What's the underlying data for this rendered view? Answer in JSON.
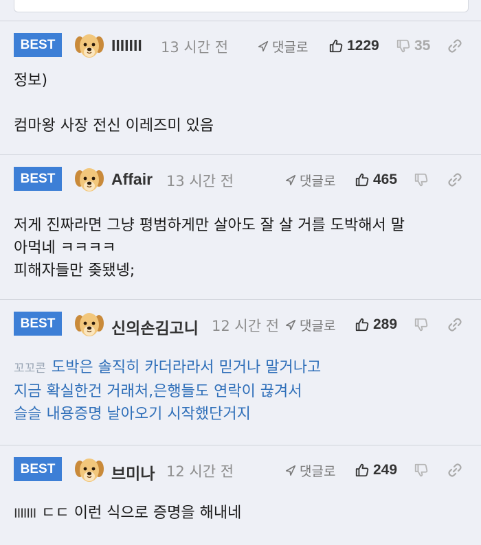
{
  "comments": [
    {
      "badge": "BEST",
      "nickname": "IIIIIII",
      "time": "13 시간 전",
      "reply_label": "댓글로",
      "likes": "1229",
      "dislikes": "35",
      "body_lines": [
        "정보)",
        "",
        "컴마왕 사장 전신 이레즈미 있음"
      ]
    },
    {
      "badge": "BEST",
      "nickname": "Affair",
      "time": "13 시간 전",
      "reply_label": "댓글로",
      "likes": "465",
      "dislikes": "",
      "body_lines": [
        "저게 진짜라면 그냥 평범하게만 살아도 잘 살 거를 도박해서 말",
        "아먹네 ㅋㅋㅋㅋ",
        "피해자들만 좆됐넹;"
      ]
    },
    {
      "badge": "BEST",
      "nickname": "신의손김고니",
      "time": "12 시간 전",
      "reply_label": "댓글로",
      "likes": "289",
      "dislikes": "",
      "prefix": "꼬꼬콘",
      "body_lines": [
        "도박은 솔직히 카더라라서 믿거나 말거나고",
        "지금 확실한건 거래처,은행들도 연락이 끊겨서",
        "슬슬 내용증명 날아오기 시작했단거지"
      ]
    },
    {
      "badge": "BEST",
      "nickname": "브미나",
      "time": "12 시간 전",
      "reply_label": "댓글로",
      "likes": "249",
      "dislikes": "",
      "mention": "IIIIIII",
      "body_lines": [
        "ㄷㄷ 이런 식으로 증명을 해내네"
      ]
    }
  ],
  "colors": {
    "badge": "#3d7fd6",
    "quote_text": "#2f6fb9",
    "background": "#eef0f6"
  },
  "icons": {
    "avatar": "puppy-avatar-icon",
    "reply": "reply-arrow-icon",
    "like": "thumbs-up-icon",
    "dislike": "thumbs-down-icon",
    "link": "link-icon"
  }
}
